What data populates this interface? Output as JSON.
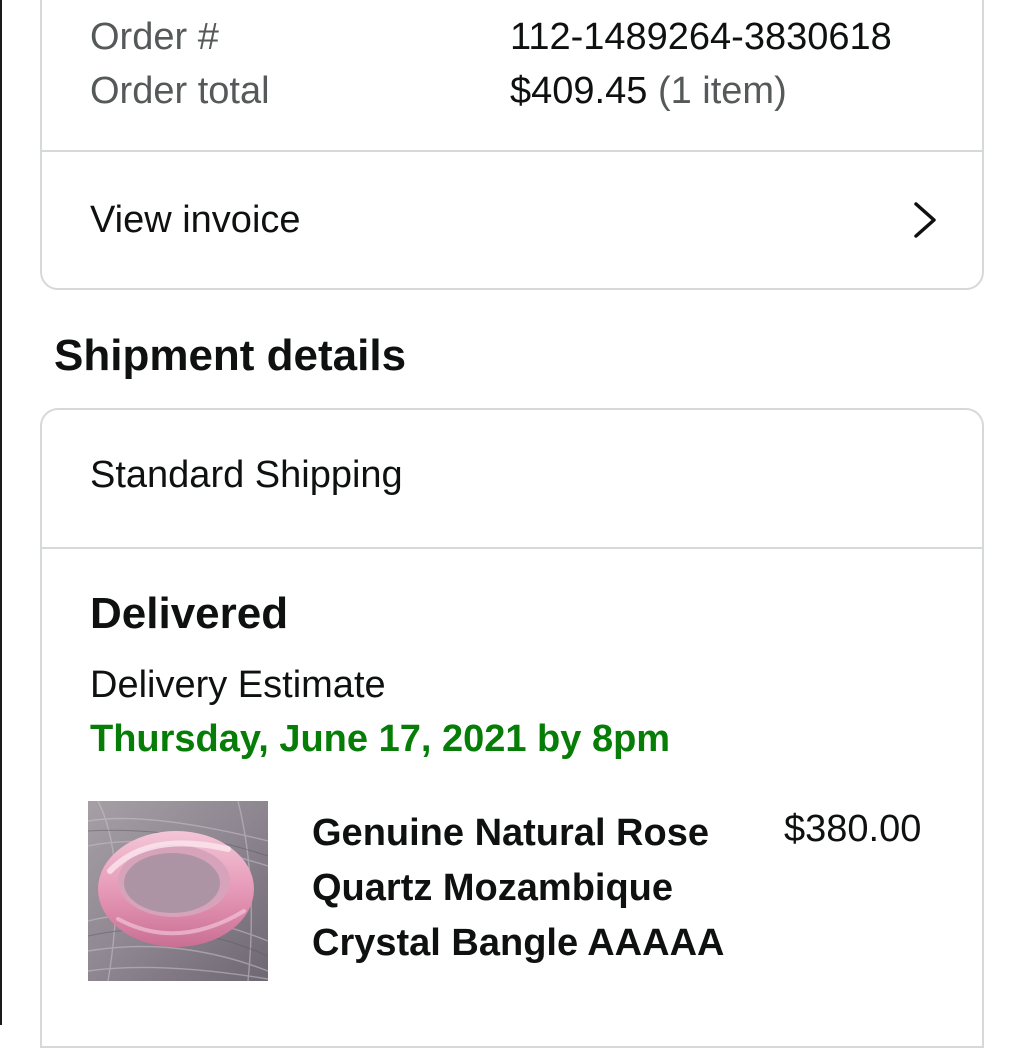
{
  "order": {
    "number_label": "Order #",
    "number_value": "112-1489264-3830618",
    "total_label": "Order total",
    "total_value": "$409.45",
    "item_count": "(1 item)",
    "invoice_label": "View invoice",
    "invoice_icon": "chevron-right-icon"
  },
  "shipment": {
    "section_title": "Shipment details",
    "method": "Standard Shipping",
    "status": "Delivered",
    "estimate_label": "Delivery Estimate",
    "estimate_date": "Thursday, June 17, 2021 by 8pm",
    "estimate_color": "#067d06"
  },
  "product": {
    "title": "Genuine Natural Rose Quartz Mozambique Crystal Bangle AAAAA",
    "price": "$380.00",
    "image_icon": "rose-quartz-bangle-photo"
  },
  "colors": {
    "border": "#d5d9d9",
    "secondary_text": "#565959",
    "primary_text": "#0f1111"
  }
}
